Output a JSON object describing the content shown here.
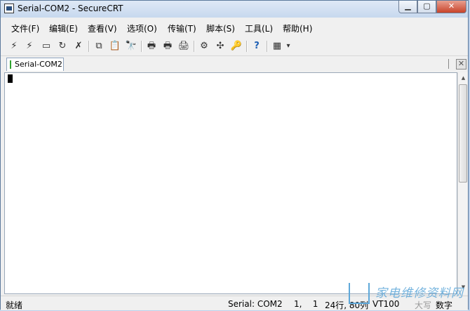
{
  "window": {
    "title": "Serial-COM2 - SecureCRT",
    "min_glyph": "▁",
    "max_glyph": "▢",
    "close_glyph": "✕"
  },
  "menu": [
    "文件(F)",
    "编辑(E)",
    "查看(V)",
    "选项(O)",
    "传输(T)",
    "脚本(S)",
    "工具(L)",
    "帮助(H)"
  ],
  "toolbar": [
    {
      "name": "connect-icon",
      "glyph": "⚡"
    },
    {
      "name": "quick-connect-icon",
      "glyph": "⚡"
    },
    {
      "name": "connect-tab-icon",
      "glyph": "▭"
    },
    {
      "name": "reconnect-icon",
      "glyph": "↻"
    },
    {
      "name": "disconnect-icon",
      "glyph": "✗"
    },
    {
      "name": "copy-icon",
      "glyph": "⧉"
    },
    {
      "name": "paste-icon",
      "glyph": "📋"
    },
    {
      "name": "find-icon",
      "glyph": "🔭"
    },
    {
      "name": "print-icon",
      "glyph": "🖶"
    },
    {
      "name": "print-selection-icon",
      "glyph": "🖶"
    },
    {
      "name": "printer-icon",
      "glyph": "🖨"
    },
    {
      "name": "session-options-icon",
      "glyph": "⚙"
    },
    {
      "name": "global-options-icon",
      "glyph": "✣"
    },
    {
      "name": "keymap-icon",
      "glyph": "🔑"
    },
    {
      "name": "help-icon",
      "glyph": "?"
    },
    {
      "name": "toolbar-options-icon",
      "glyph": "▦"
    },
    {
      "name": "toolbar-overflow-icon",
      "glyph": "▾"
    }
  ],
  "tab": {
    "label": "Serial-COM2",
    "close_glyph": "✕"
  },
  "status": {
    "ready": "就绪",
    "serial": "Serial: COM2",
    "position": "1,    1",
    "size": "24行, 80列",
    "emulation": "VT100",
    "caps": "大写",
    "num": "数字"
  },
  "watermark": "家电维修资料网"
}
